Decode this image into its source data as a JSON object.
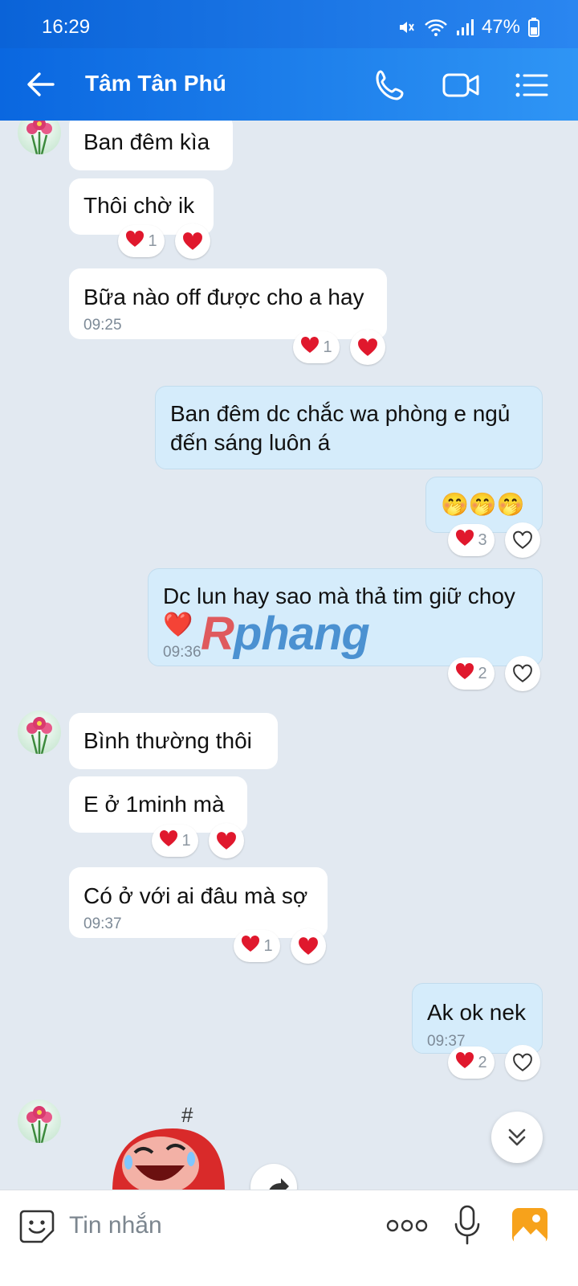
{
  "status_bar": {
    "time": "16:29",
    "battery": "47%"
  },
  "header": {
    "title": "Tâm Tân Phú"
  },
  "messages": [
    {
      "text": "Ban đêm kìa"
    },
    {
      "text": "Thôi chờ ik",
      "reaction_count": "1"
    },
    {
      "text": "Bữa nào off được cho a hay",
      "time": "09:25",
      "reaction_count": "1"
    },
    {
      "text": "Ban đêm dc chắc wa phòng e ngủ đến sáng luôn á"
    },
    {
      "text": "🤭🤭🤭",
      "reaction_count": "3"
    },
    {
      "text": "Dc lun hay sao mà thả tim giữ choy",
      "emoji": "❤️",
      "time": "09:36",
      "reaction_count": "2"
    },
    {
      "text": "Bình thường thôi"
    },
    {
      "text": "E ở 1minh mà",
      "reaction_count": "1"
    },
    {
      "text": "Có ở với ai đâu mà sợ",
      "time": "09:37",
      "reaction_count": "1"
    },
    {
      "text": "Ak ok nek",
      "time": "09:37",
      "reaction_count": "2"
    }
  ],
  "watermark": {
    "prefix": "R",
    "rest": "phang"
  },
  "sticker": {
    "symbol": "#"
  },
  "composer": {
    "placeholder": "Tin nhắn"
  }
}
